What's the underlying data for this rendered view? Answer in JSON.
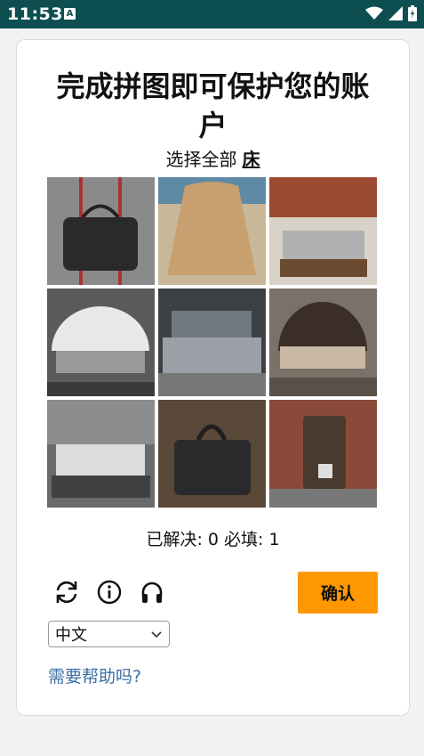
{
  "status_bar": {
    "time": "11:53",
    "notif_letter": "A"
  },
  "captcha": {
    "title": "完成拼图即可保护您的账户",
    "instruction_prefix": "选择全部",
    "target_word": "床",
    "tiles": [
      {
        "subject": "bag-icon"
      },
      {
        "subject": "bag-icon"
      },
      {
        "subject": "bed-icon"
      },
      {
        "subject": "bed-icon"
      },
      {
        "subject": "bed-icon"
      },
      {
        "subject": "bed-icon"
      },
      {
        "subject": "bed-icon"
      },
      {
        "subject": "bag-icon"
      },
      {
        "subject": "bag-icon"
      }
    ],
    "progress_text": "已解决: 0 必填: 1",
    "confirm_label": "确认",
    "language": "中文",
    "help_link": "需要帮助吗?"
  },
  "colors": {
    "status_bar": "#0d4f51",
    "confirm_button": "#ff9800",
    "link": "#3a6ea5"
  }
}
